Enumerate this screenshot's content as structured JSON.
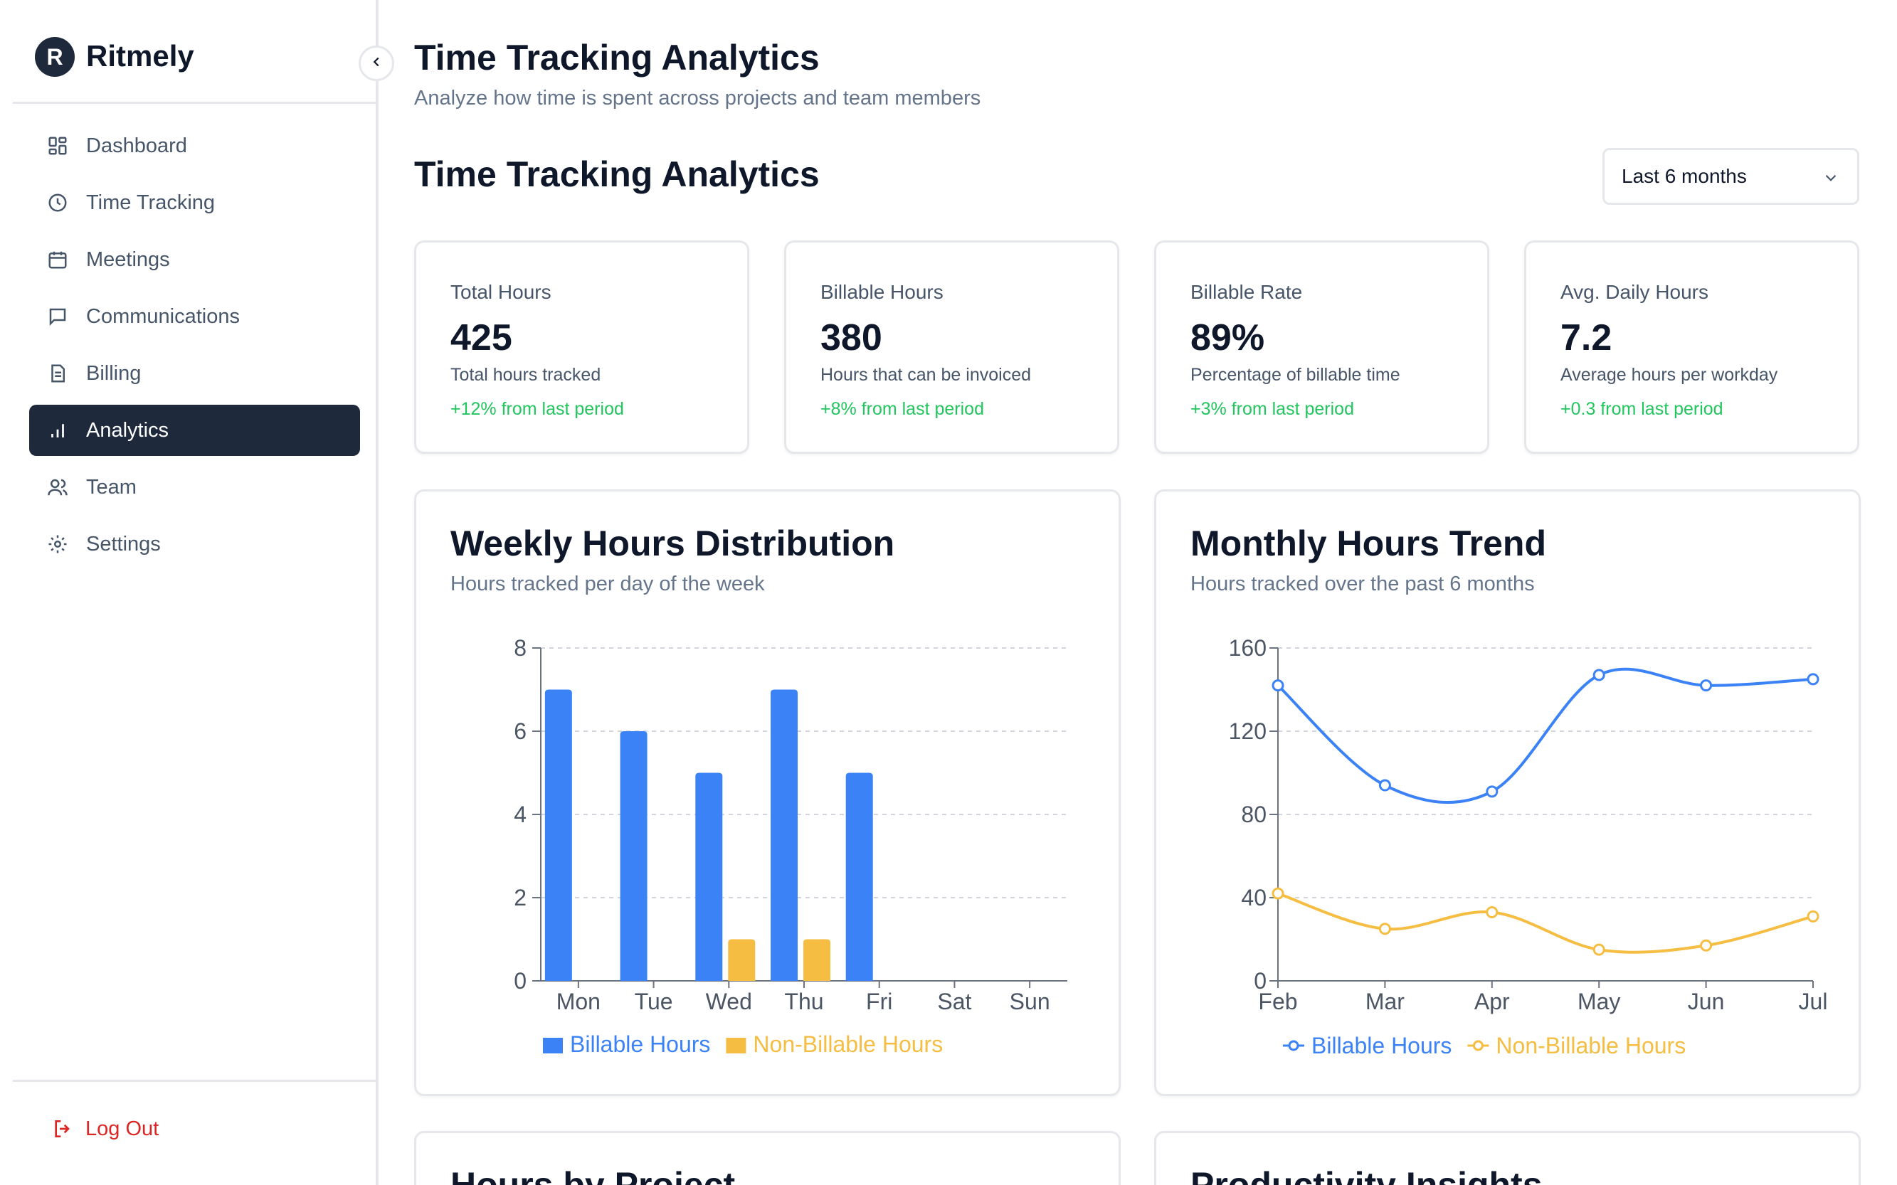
{
  "brand": {
    "logo_letter": "R",
    "name": "Ritmely"
  },
  "sidebar": {
    "items": [
      {
        "label": "Dashboard",
        "icon": "dashboard-icon",
        "active": false
      },
      {
        "label": "Time Tracking",
        "icon": "clock-icon",
        "active": false
      },
      {
        "label": "Meetings",
        "icon": "calendar-icon",
        "active": false
      },
      {
        "label": "Communications",
        "icon": "message-icon",
        "active": false
      },
      {
        "label": "Billing",
        "icon": "document-icon",
        "active": false
      },
      {
        "label": "Analytics",
        "icon": "bar-chart-icon",
        "active": true
      },
      {
        "label": "Team",
        "icon": "users-icon",
        "active": false
      },
      {
        "label": "Settings",
        "icon": "gear-icon",
        "active": false
      }
    ],
    "logout_label": "Log Out"
  },
  "header": {
    "title": "Time Tracking Analytics",
    "subtitle": "Analyze how time is spent across projects and team members"
  },
  "section": {
    "title": "Time Tracking Analytics",
    "range_value": "Last 6 months"
  },
  "stats": [
    {
      "label": "Total Hours",
      "value": "425",
      "description": "Total hours tracked",
      "change": "+12% from last period"
    },
    {
      "label": "Billable Hours",
      "value": "380",
      "description": "Hours that can be invoiced",
      "change": "+8% from last period"
    },
    {
      "label": "Billable Rate",
      "value": "89%",
      "description": "Percentage of billable time",
      "change": "+3% from last period"
    },
    {
      "label": "Avg. Daily Hours",
      "value": "7.2",
      "description": "Average hours per workday",
      "change": "+0.3 from last period"
    }
  ],
  "weekly_card": {
    "title": "Weekly Hours Distribution",
    "subtitle": "Hours tracked per day of the week"
  },
  "monthly_card": {
    "title": "Monthly Hours Trend",
    "subtitle": "Hours tracked over the past 6 months"
  },
  "bottom_cards": {
    "left_title": "Hours by Project",
    "right_title": "Productivity Insights"
  },
  "colors": {
    "billable": "#3b82f6",
    "non_billable": "#f5bd42",
    "active_nav": "#1e293b",
    "positive": "#22c55e",
    "danger": "#dc2626"
  },
  "chart_data": [
    {
      "type": "bar",
      "categories": [
        "Mon",
        "Tue",
        "Wed",
        "Thu",
        "Fri",
        "Sat",
        "Sun"
      ],
      "series": [
        {
          "name": "Billable Hours",
          "values": [
            7,
            6,
            5,
            7,
            5,
            0,
            0
          ]
        },
        {
          "name": "Non-Billable Hours",
          "values": [
            0,
            0,
            1,
            1,
            0,
            0,
            0
          ]
        }
      ],
      "yticks": [
        0,
        2,
        4,
        6,
        8
      ],
      "ylim": [
        0,
        8
      ],
      "grid": true,
      "legend": "bottom"
    },
    {
      "type": "line",
      "x": [
        "Feb",
        "Mar",
        "Apr",
        "May",
        "Jun",
        "Jul"
      ],
      "series": [
        {
          "name": "Billable Hours",
          "values": [
            142,
            94,
            91,
            147,
            142,
            145
          ]
        },
        {
          "name": "Non-Billable Hours",
          "values": [
            42,
            25,
            33,
            15,
            17,
            31
          ]
        }
      ],
      "yticks": [
        0,
        40,
        80,
        120,
        160
      ],
      "ylim": [
        0,
        160
      ],
      "grid": true,
      "legend": "bottom"
    }
  ]
}
